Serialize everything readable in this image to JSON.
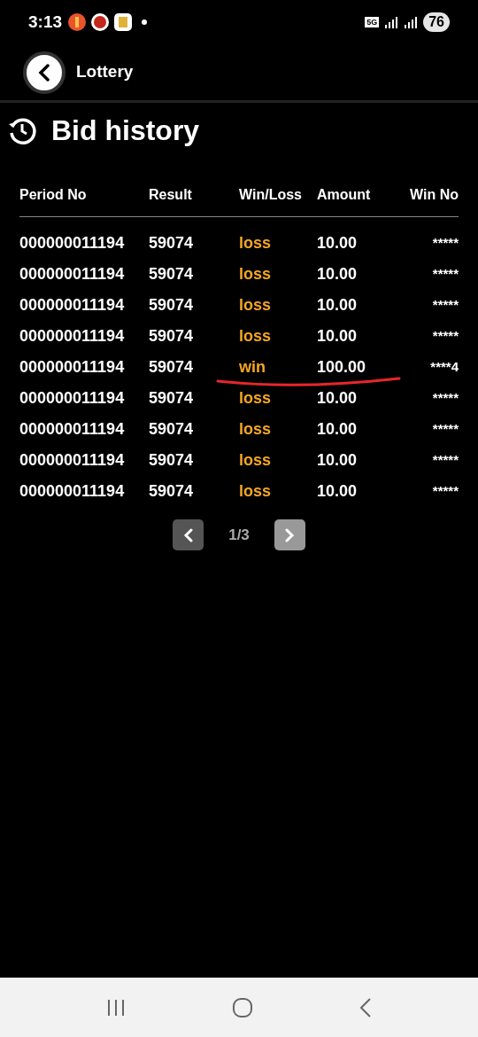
{
  "status_bar": {
    "time": "3:13",
    "network": "5G",
    "battery": "76"
  },
  "header": {
    "title": "Lottery"
  },
  "page_title": "Bid history",
  "table": {
    "columns": [
      "Period No",
      "Result",
      "Win/Loss",
      "Amount",
      "Win No"
    ],
    "rows": [
      {
        "period": "000000011194",
        "result": "59074",
        "outcome": "loss",
        "amount": "10.00",
        "win_no": "*****",
        "underlined": false
      },
      {
        "period": "000000011194",
        "result": "59074",
        "outcome": "loss",
        "amount": "10.00",
        "win_no": "*****",
        "underlined": false
      },
      {
        "period": "000000011194",
        "result": "59074",
        "outcome": "loss",
        "amount": "10.00",
        "win_no": "*****",
        "underlined": false
      },
      {
        "period": "000000011194",
        "result": "59074",
        "outcome": "loss",
        "amount": "10.00",
        "win_no": "*****",
        "underlined": false
      },
      {
        "period": "000000011194",
        "result": "59074",
        "outcome": "win",
        "amount": "100.00",
        "win_no": "****4",
        "underlined": true
      },
      {
        "period": "000000011194",
        "result": "59074",
        "outcome": "loss",
        "amount": "10.00",
        "win_no": "*****",
        "underlined": false
      },
      {
        "period": "000000011194",
        "result": "59074",
        "outcome": "loss",
        "amount": "10.00",
        "win_no": "*****",
        "underlined": false
      },
      {
        "period": "000000011194",
        "result": "59074",
        "outcome": "loss",
        "amount": "10.00",
        "win_no": "*****",
        "underlined": false
      },
      {
        "period": "000000011194",
        "result": "59074",
        "outcome": "loss",
        "amount": "10.00",
        "win_no": "*****",
        "underlined": false
      }
    ]
  },
  "pagination": {
    "label": "1/3",
    "prev_disabled": true,
    "next_disabled": false
  }
}
